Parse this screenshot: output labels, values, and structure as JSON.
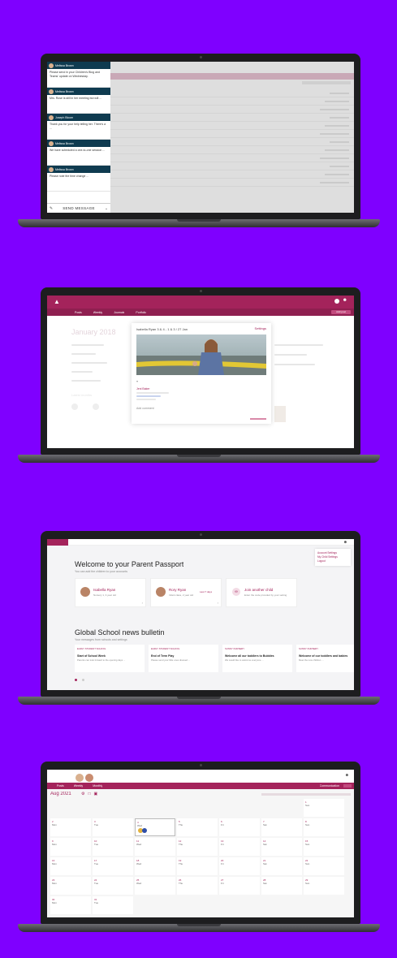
{
  "colors": {
    "background": "#7f00ff",
    "brand": "#a4235b",
    "teal": "#0f3b50",
    "laptop": "#1d1d1f"
  },
  "messages": {
    "send_button": "SEND MESSAGE",
    "threads": [
      {
        "sender": "Melissa Brown",
        "text": "Please send in your Children's Blog and Teams' update on Wednesday."
      },
      {
        "sender": "Melissa Brown",
        "text": "Mrs. Rose is still in her meeting but will ..."
      },
      {
        "sender": "Joseph Bloom",
        "text": "Thank you for your help telling her. There's a ..."
      },
      {
        "sender": "Melissa Brown",
        "text": "We have scheduled a one-to-one session ..."
      },
      {
        "sender": "Melissa Brown",
        "text": "Please note the time change ..."
      }
    ]
  },
  "journal": {
    "nav": [
      "Posts",
      "Weekly",
      "Journals",
      "Portfolio"
    ],
    "month_title": "January 2018",
    "post_title": "Isabella Ryan 3 & 4 - 1 & 3 / 27 Jan",
    "add_post_button": "Add post",
    "post_author": "Jeni Baker",
    "add_comment": "Add comment",
    "settings_link": "Settings",
    "hidden_label": "Latest months"
  },
  "passport": {
    "welcome_title": "Welcome to your Parent Passport",
    "welcome_sub": "You can add the children to your accounts",
    "menu": [
      "Account Settings",
      "My Child Settings",
      "Logout"
    ],
    "children": [
      {
        "name": "Isabella Ryan",
        "detail": "Nursery 1, 3 year old",
        "extra": ""
      },
      {
        "name": "Rory Ryan",
        "detail": "Infant class, 2 year old",
        "extra": "Last 7 days"
      }
    ],
    "add_child_title": "Join another child",
    "add_child_detail": "Enter the code provided by your setting",
    "news_title": "Global School news bulletin",
    "news_sub": "Your messages from schools and settings",
    "news": [
      {
        "tag": "EARLY STUDENT SCHOOL",
        "title": "Start of School Week",
        "body": "Parents can look forward to the opening days ..."
      },
      {
        "tag": "EARLY STUDENT SCHOOL",
        "title": "End of Term Play",
        "body": "Please send your little ones dressed ..."
      },
      {
        "tag": "SUNNY NURSERY",
        "title": "Welcome all our toddlers to Bubbles",
        "body": "We would like to welcome everyone ..."
      },
      {
        "tag": "SUNNY NURSERY",
        "title": "Welcome of our toddlers and babies",
        "body": "Meet the new children ..."
      }
    ]
  },
  "calendar": {
    "nav": [
      "Posts",
      "Weekly",
      "Monthly"
    ],
    "month": "Aug 2021",
    "right_button": "Communication",
    "weekdays": [
      "Mon",
      "Tue",
      "Wed",
      "Thu",
      "Fri",
      "Sat",
      "Sun"
    ],
    "days": [
      "1",
      "2",
      "3",
      "4",
      "5",
      "6",
      "7",
      "8",
      "9",
      "10",
      "11",
      "12",
      "13",
      "14",
      "15",
      "16",
      "17",
      "18",
      "19",
      "20",
      "21",
      "22",
      "23",
      "24",
      "25",
      "26",
      "27",
      "28",
      "29",
      "30",
      "31"
    ]
  }
}
